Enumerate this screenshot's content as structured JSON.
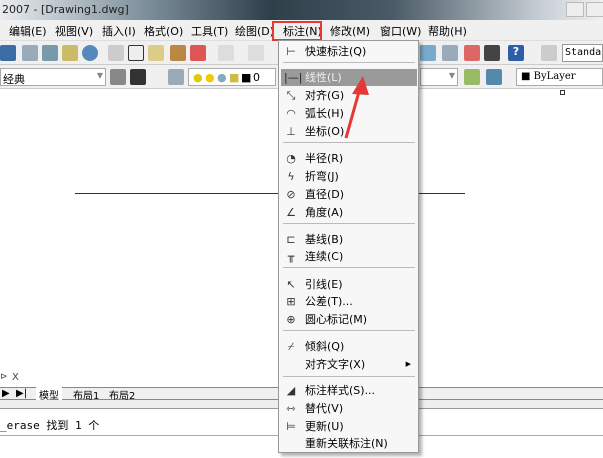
{
  "window": {
    "title": "2007 - [Drawing1.dwg]"
  },
  "menubar": [
    "编辑(E)",
    "视图(V)",
    "插入(I)",
    "格式(O)",
    "工具(T)",
    "绘图(D)",
    "标注(N)",
    "修改(M)",
    "窗口(W)",
    "帮助(H)"
  ],
  "toolbar": {
    "workspace": "经典",
    "layer_value": "0",
    "text_style": "Standa",
    "color": "ByLayer"
  },
  "dimension_menu": {
    "items": [
      {
        "label": "快速标注(Q)",
        "icon": "quick-dim-icon"
      },
      {
        "label": "线性(L)",
        "icon": "linear-icon",
        "selected": true
      },
      {
        "label": "对齐(G)",
        "icon": "aligned-icon"
      },
      {
        "label": "弧长(H)",
        "icon": "arc-length-icon"
      },
      {
        "label": "坐标(O)",
        "icon": "ordinate-icon"
      },
      {
        "label": "半径(R)",
        "icon": "radius-icon"
      },
      {
        "label": "折弯(J)",
        "icon": "jogged-icon"
      },
      {
        "label": "直径(D)",
        "icon": "diameter-icon"
      },
      {
        "label": "角度(A)",
        "icon": "angular-icon"
      },
      {
        "label": "基线(B)",
        "icon": "baseline-icon"
      },
      {
        "label": "连续(C)",
        "icon": "continue-icon"
      },
      {
        "label": "引线(E)",
        "icon": "leader-icon"
      },
      {
        "label": "公差(T)...",
        "icon": "tolerance-icon"
      },
      {
        "label": "圆心标记(M)",
        "icon": "center-mark-icon"
      },
      {
        "label": "倾斜(Q)",
        "icon": "oblique-icon"
      },
      {
        "label": "对齐文字(X)",
        "icon": "",
        "submenu": true
      },
      {
        "label": "标注样式(S)...",
        "icon": "dim-style-icon"
      },
      {
        "label": "替代(V)",
        "icon": "override-icon"
      },
      {
        "label": "更新(U)",
        "icon": "update-icon"
      },
      {
        "label": "重新关联标注(N)",
        "icon": ""
      }
    ]
  },
  "ucs_label": "X",
  "layout_tabs": [
    "模型",
    "布局1",
    "布局2"
  ],
  "command_line": "_erase 找到 1 个",
  "colors": {
    "highlight_box": "#e53935",
    "arrow": "#e53935",
    "selected_item": "#9a9a9a"
  }
}
